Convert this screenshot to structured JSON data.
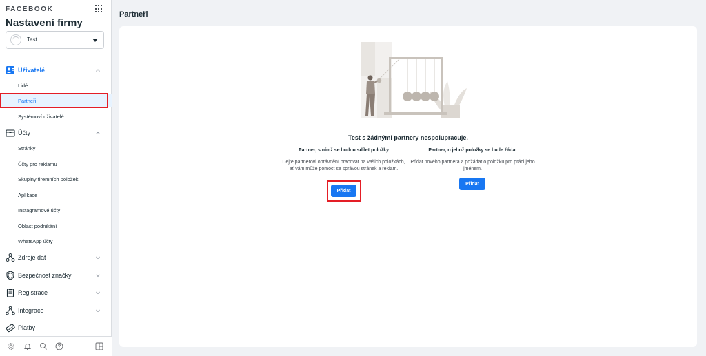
{
  "sidebar": {
    "brand": "FACEBOOK",
    "business_title": "Nastavení firmy",
    "account_selector": {
      "value": "Test"
    },
    "sections": [
      {
        "key": "users",
        "label": "Uživatelé",
        "icon": "person-badge-icon",
        "expanded": true,
        "active": true,
        "items": [
          {
            "label": "Lidé"
          },
          {
            "label": "Partneři",
            "selected": true
          },
          {
            "label": "Systémoví uživatelé"
          }
        ]
      },
      {
        "key": "accounts",
        "label": "Účty",
        "icon": "folder-icon",
        "expanded": true,
        "items": [
          {
            "label": "Stránky"
          },
          {
            "label": "Účty pro reklamu"
          },
          {
            "label": "Skupiny firemních položek"
          },
          {
            "label": "Aplikace"
          },
          {
            "label": "Instagramové účty"
          },
          {
            "label": "Oblast podnikání"
          },
          {
            "label": "WhatsApp účty"
          }
        ]
      },
      {
        "key": "data_sources",
        "label": "Zdroje dat",
        "icon": "people-network-icon"
      },
      {
        "key": "brand_safety",
        "label": "Bezpečnost značky",
        "icon": "shield-icon"
      },
      {
        "key": "registration",
        "label": "Registrace",
        "icon": "clipboard-icon"
      },
      {
        "key": "integrations",
        "label": "Integrace",
        "icon": "integration-nodes-icon"
      },
      {
        "key": "payments",
        "label": "Platby",
        "icon": "card-tag-icon"
      }
    ],
    "bottom_icons": [
      "settings-gear-icon",
      "bell-icon",
      "search-icon",
      "help-question-icon",
      "panel-toggle-icon"
    ]
  },
  "main": {
    "page_title": "Partneři",
    "empty_state": {
      "title": "Test s žádnými partnery nespolupracuje.",
      "share": {
        "title": "Partner, s nímž se budou sdílet položky",
        "description": "Dejte partnerovi oprávnění pracovat na vašich položkách, ať vám může pomoct se správou stránek a reklam.",
        "button": "Přidat"
      },
      "request": {
        "title": "Partner, o jehož položky se bude žádat",
        "description": "Přidat nového partnera a požádat o položku pro práci jeho jménem.",
        "button": "Přidat"
      }
    }
  },
  "colors": {
    "accent": "#1877f2",
    "highlight": "#e41e26",
    "selected_bg": "#e7f3ff"
  }
}
